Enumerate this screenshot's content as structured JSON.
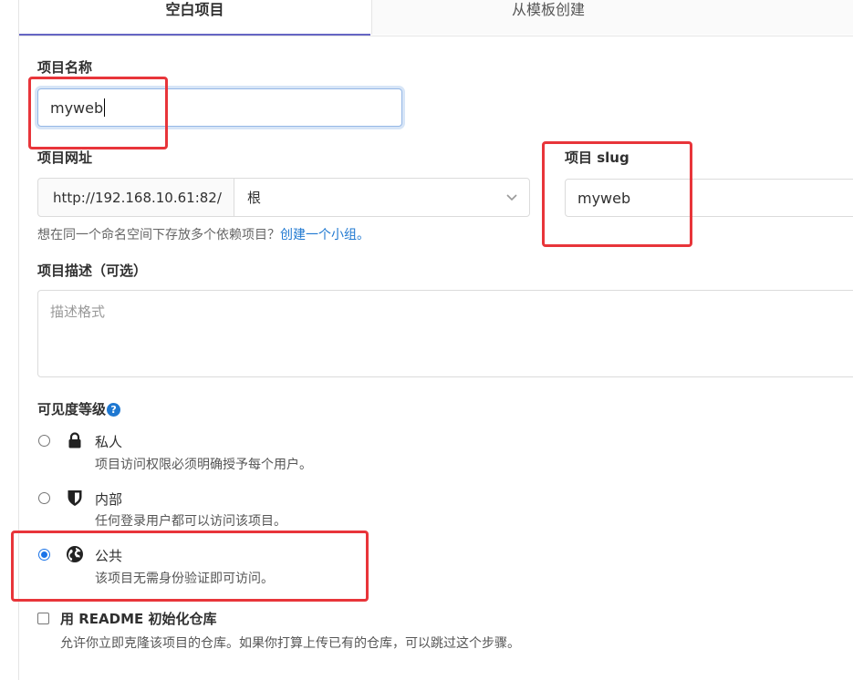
{
  "tabs": [
    {
      "label": "空白项目",
      "active": true
    },
    {
      "label": "从模板创建",
      "active": false
    }
  ],
  "project_name": {
    "label": "项目名称",
    "value": "myweb"
  },
  "project_url": {
    "label": "项目网址",
    "prefix": "http://192.168.10.61:82/",
    "namespace": "根"
  },
  "project_slug": {
    "label": "项目 slug",
    "value": "myweb"
  },
  "url_help": {
    "text": "想在同一个命名空间下存放多个依赖项目？",
    "link": "创建一个小组。"
  },
  "description": {
    "label": "项目描述（可选）",
    "placeholder": "描述格式"
  },
  "visibility": {
    "label": "可见度等级",
    "help_icon": "question-icon",
    "options": [
      {
        "title": "私人",
        "desc": "项目访问权限必须明确授予每个用户。",
        "icon": "lock-icon",
        "selected": false
      },
      {
        "title": "内部",
        "desc": "任何登录用户都可以访问该项目。",
        "icon": "shield-icon",
        "selected": false
      },
      {
        "title": "公共",
        "desc": "该项目无需身份验证即可访问。",
        "icon": "globe-icon",
        "selected": true
      }
    ]
  },
  "readme": {
    "label": "用 README 初始化仓库",
    "desc": "允许你立即克隆该项目的仓库。如果你打算上传已有的仓库，可以跳过这个步骤。",
    "checked": false
  },
  "colors": {
    "accent": "#6666c4",
    "link": "#1f78d1",
    "annotation": "#e8353a"
  }
}
